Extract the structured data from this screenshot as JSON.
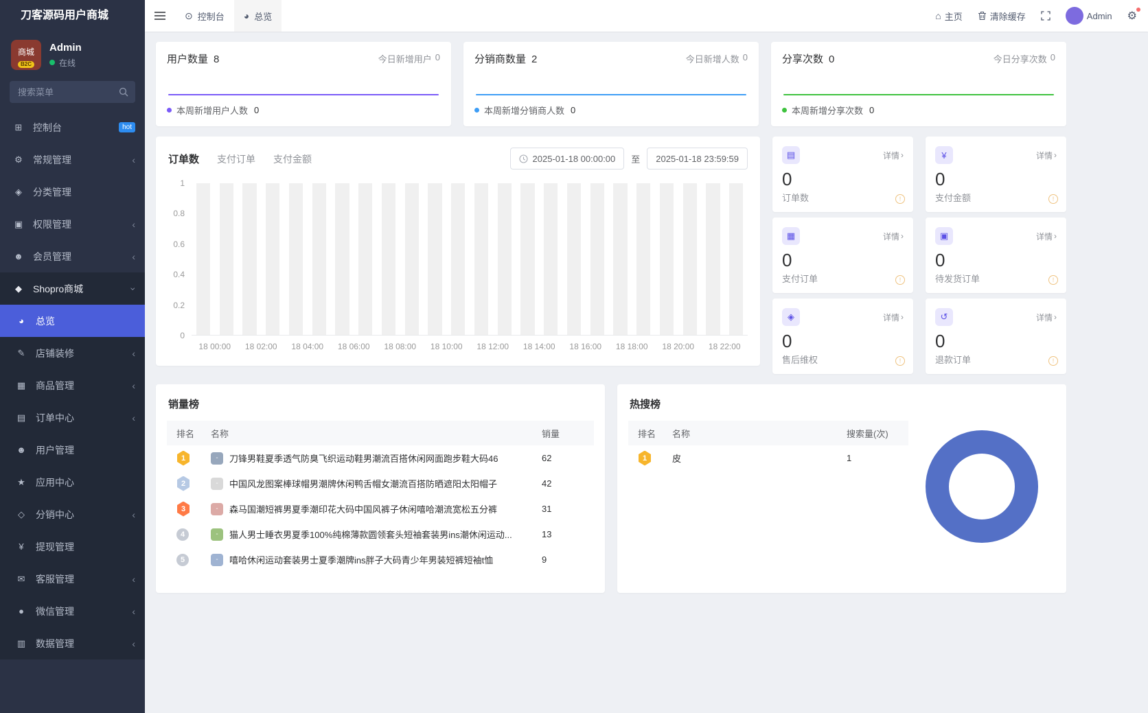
{
  "app": {
    "brand": "刀客源码用户商城"
  },
  "theme": {
    "accent": "#4b5eda",
    "sidebar_bg": "#2b3245",
    "submenu_bg": "#222937",
    "page_bg": "#eef0f4",
    "badge_hot": "#2d8cf0",
    "online": "#19be6b",
    "chip_bg": "#e9e7fd",
    "chip_fg": "#5c51e6",
    "medal_gold": "#f7b52c",
    "medal_silver": "#b6c9e4",
    "medal_bronze": "#ff7a45",
    "medal_gray": "#c6cbd4",
    "warn": "#e6a23c",
    "bar_bg": "#f0f0f0",
    "donut": "#5470c6",
    "topbar_active": "#f5f5f5"
  },
  "icons": {
    "dashboard": "⊞",
    "cogs": "⚙",
    "category": "◈",
    "permission": "▣",
    "member": "☻",
    "shop": "◆",
    "overview": "◕",
    "decorate": "✎",
    "goods": "▦",
    "order": "▤",
    "user": "☻",
    "app": "★",
    "distribution": "◇",
    "withdraw": "¥",
    "service": "✉",
    "wechat": "●",
    "data": "▥",
    "console_tab": "⊙",
    "home": "⌂",
    "gear": "⚙",
    "chevron_left": "‹",
    "chevron_right": "›",
    "mini_order": "▤",
    "mini_money": "¥",
    "mini_pay": "▦",
    "mini_ship": "▣",
    "mini_aftersale": "◈",
    "mini_refund": "↺",
    "warning": "!"
  },
  "sidebar": {
    "user": {
      "name": "Admin",
      "status": "在线",
      "avatar_text": "商城",
      "avatar_badge": "B2C"
    },
    "search_placeholder": "搜索菜单",
    "items": [
      {
        "label": "控制台",
        "badge": "hot"
      },
      {
        "label": "常规管理"
      },
      {
        "label": "分类管理"
      },
      {
        "label": "权限管理"
      },
      {
        "label": "会员管理"
      },
      {
        "label": "Shopro商城"
      },
      {
        "label": "总览"
      },
      {
        "label": "店铺装修"
      },
      {
        "label": "商品管理"
      },
      {
        "label": "订单中心"
      },
      {
        "label": "用户管理"
      },
      {
        "label": "应用中心"
      },
      {
        "label": "分销中心"
      },
      {
        "label": "提现管理"
      },
      {
        "label": "客服管理"
      },
      {
        "label": "微信管理"
      },
      {
        "label": "数据管理"
      }
    ]
  },
  "topbar": {
    "tabs": [
      {
        "label": "控制台"
      },
      {
        "label": "总览"
      }
    ],
    "home": "主页",
    "clear_cache": "清除缓存",
    "username": "Admin"
  },
  "stat_cards": [
    {
      "title": "用户数量",
      "value": "8",
      "today_label": "今日新增用户",
      "today_value": "0",
      "week_label": "本周新增用户人数",
      "week_value": "0",
      "color": "#7a5af8",
      "sparkline": [
        0,
        0,
        0,
        0,
        0,
        0
      ]
    },
    {
      "title": "分销商数量",
      "value": "2",
      "today_label": "今日新增人数",
      "today_value": "0",
      "week_label": "本周新增分销商人数",
      "week_value": "0",
      "color": "#3d9df6",
      "sparkline": [
        0,
        0,
        0,
        0,
        0,
        0
      ]
    },
    {
      "title": "分享次数",
      "value": "0",
      "today_label": "今日分享次数",
      "today_value": "0",
      "week_label": "本周新增分享次数",
      "week_value": "0",
      "color": "#3ec23e",
      "sparkline": [
        0,
        0,
        0,
        0,
        0,
        0
      ]
    }
  ],
  "order_chart": {
    "tabs": [
      "订单数",
      "支付订单",
      "支付金额"
    ],
    "date_start": "2025-01-18 00:00:00",
    "date_separator": "至",
    "date_end": "2025-01-18 23:59:59",
    "chart_data": {
      "type": "bar",
      "title": "订单数（按小时）",
      "x": [
        "18 00:00",
        "18 01:00",
        "18 02:00",
        "18 03:00",
        "18 04:00",
        "18 05:00",
        "18 06:00",
        "18 07:00",
        "18 08:00",
        "18 09:00",
        "18 10:00",
        "18 11:00",
        "18 12:00",
        "18 13:00",
        "18 14:00",
        "18 15:00",
        "18 16:00",
        "18 17:00",
        "18 18:00",
        "18 19:00",
        "18 20:00",
        "18 21:00",
        "18 22:00",
        "18 23:00"
      ],
      "values": [
        0,
        0,
        0,
        0,
        0,
        0,
        0,
        0,
        0,
        0,
        0,
        0,
        0,
        0,
        0,
        0,
        0,
        0,
        0,
        0,
        0,
        0,
        0,
        0
      ],
      "x_tick_labels": [
        "18 00:00",
        "18 02:00",
        "18 04:00",
        "18 06:00",
        "18 08:00",
        "18 10:00",
        "18 12:00",
        "18 14:00",
        "18 16:00",
        "18 18:00",
        "18 20:00",
        "18 22:00"
      ],
      "yticks": [
        0,
        0.2,
        0.4,
        0.6,
        0.8,
        1
      ],
      "ylim": [
        0,
        1
      ],
      "note": "all hourly values are 0; light gray background placeholder bars are shown"
    }
  },
  "mini_cards": [
    {
      "value": "0",
      "label": "订单数",
      "detail": "详情"
    },
    {
      "value": "0",
      "label": "支付金额",
      "detail": "详情"
    },
    {
      "value": "0",
      "label": "支付订单",
      "detail": "详情"
    },
    {
      "value": "0",
      "label": "待发货订单",
      "detail": "详情"
    },
    {
      "value": "0",
      "label": "售后维权",
      "detail": "详情"
    },
    {
      "value": "0",
      "label": "退款订单",
      "detail": "详情"
    }
  ],
  "sales_rank": {
    "title": "销量榜",
    "headers": [
      "排名",
      "名称",
      "销量"
    ],
    "rows": [
      {
        "rank": "1",
        "name": "刀锋男鞋夏季透气防臭飞织运动鞋男潮流百搭休闲网面跑步鞋大码46",
        "value": "62",
        "thumb": "#97a7bc"
      },
      {
        "rank": "2",
        "name": "中国风龙图案棒球帽男潮牌休闲鸭舌帽女潮流百搭防晒遮阳太阳帽子",
        "value": "42",
        "thumb": "#d9d9d9"
      },
      {
        "rank": "3",
        "name": "森马国潮短裤男夏季潮印花大码中国风裤子休闲嘻哈潮流宽松五分裤",
        "value": "31",
        "thumb": "#dcaaa6"
      },
      {
        "rank": "4",
        "name": "猫人男士睡衣男夏季100%纯棉薄款圆领套头短袖套装男ins潮休闲运动...",
        "value": "13",
        "thumb": "#9cc27e"
      },
      {
        "rank": "5",
        "name": "嘻哈休闲运动套装男士夏季潮牌ins胖子大码青少年男装短裤短袖t恤",
        "value": "9",
        "thumb": "#9fb3d2"
      }
    ]
  },
  "hot_search": {
    "title": "热搜榜",
    "headers": [
      "排名",
      "名称",
      "搜索量(次)"
    ],
    "rows": [
      {
        "rank": "1",
        "name": "皮",
        "value": "1"
      }
    ],
    "chart_data": {
      "type": "pie",
      "donut": true,
      "labels": [
        "皮"
      ],
      "values": [
        1
      ],
      "color": "#5470c6"
    }
  }
}
